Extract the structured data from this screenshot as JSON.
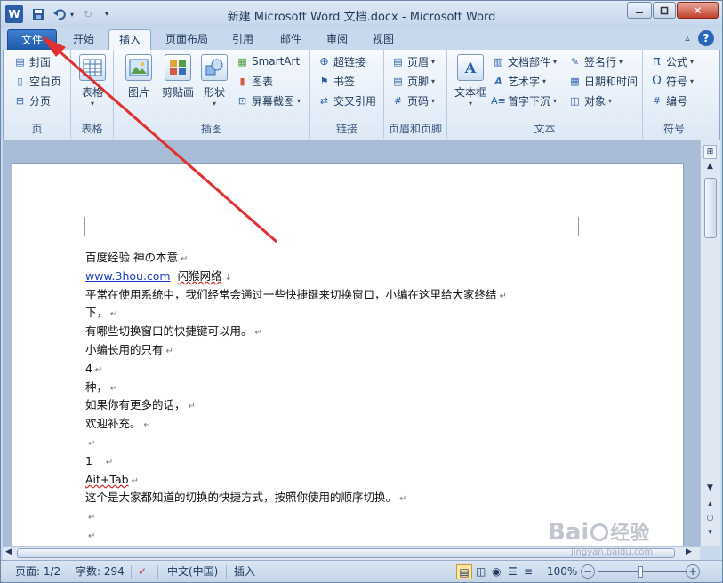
{
  "window": {
    "title": "新建 Microsoft Word 文档.docx - Microsoft Word",
    "app_icon": "W",
    "undo_icon": "undo-icon",
    "redo_icon": "redo-icon"
  },
  "tabs": [
    {
      "label": "文件"
    },
    {
      "label": "开始"
    },
    {
      "label": "插入"
    },
    {
      "label": "页面布局"
    },
    {
      "label": "引用"
    },
    {
      "label": "邮件"
    },
    {
      "label": "审阅"
    },
    {
      "label": "视图"
    }
  ],
  "ribbon": {
    "pages": {
      "label": "页",
      "cover": "封面",
      "blank": "空白页",
      "break": "分页"
    },
    "tables": {
      "label": "表格",
      "table": "表格"
    },
    "illustrations": {
      "label": "插图",
      "picture": "图片",
      "clipart": "剪贴画",
      "shapes": "形状",
      "smartart": "SmartArt",
      "chart": "图表",
      "screenshot": "屏幕截图"
    },
    "links": {
      "label": "链接",
      "hyperlink": "超链接",
      "bookmark": "书签",
      "crossref": "交叉引用"
    },
    "header_footer": {
      "label": "页眉和页脚",
      "header": "页眉",
      "footer": "页脚",
      "page_number": "页码"
    },
    "text": {
      "label": "文本",
      "textbox": "文本框",
      "quickparts": "文档部件",
      "wordart": "艺术字",
      "dropcap": "首字下沉",
      "signature": "签名行",
      "datetime": "日期和时间",
      "object": "对象"
    },
    "symbols": {
      "label": "符号",
      "equation": "公式",
      "symbol": "符号",
      "number": "编号"
    }
  },
  "document": {
    "lines": [
      "百度经验  神の本意",
      "www.3hou.com",
      "闪猴网络",
      "平常在使用系统中，我们经常会通过一些快捷键来切换窗口，小编在这里给大家终结",
      "下，",
      "有哪些切换窗口的快捷键可以用。",
      "小编长用的只有",
      "4",
      "种，",
      "如果你有更多的话，",
      "欢迎补充。",
      "",
      "1",
      "Ait+Tab",
      "这个是大家都知道的切换的快捷方式，按照你使用的顺序切换。",
      "",
      ""
    ]
  },
  "status": {
    "page": "页面: 1/2",
    "words": "字数: 294",
    "language": "中文(中国)",
    "mode": "插入",
    "zoom": "100%"
  },
  "watermark": {
    "brand": "Bai",
    "brand2": "经验",
    "url": "jingyan.baidu.com"
  },
  "colors": {
    "file_tab": "#2a66b8",
    "annotation_arrow": "#e03030",
    "ribbon_bg": "#dde8f5"
  }
}
